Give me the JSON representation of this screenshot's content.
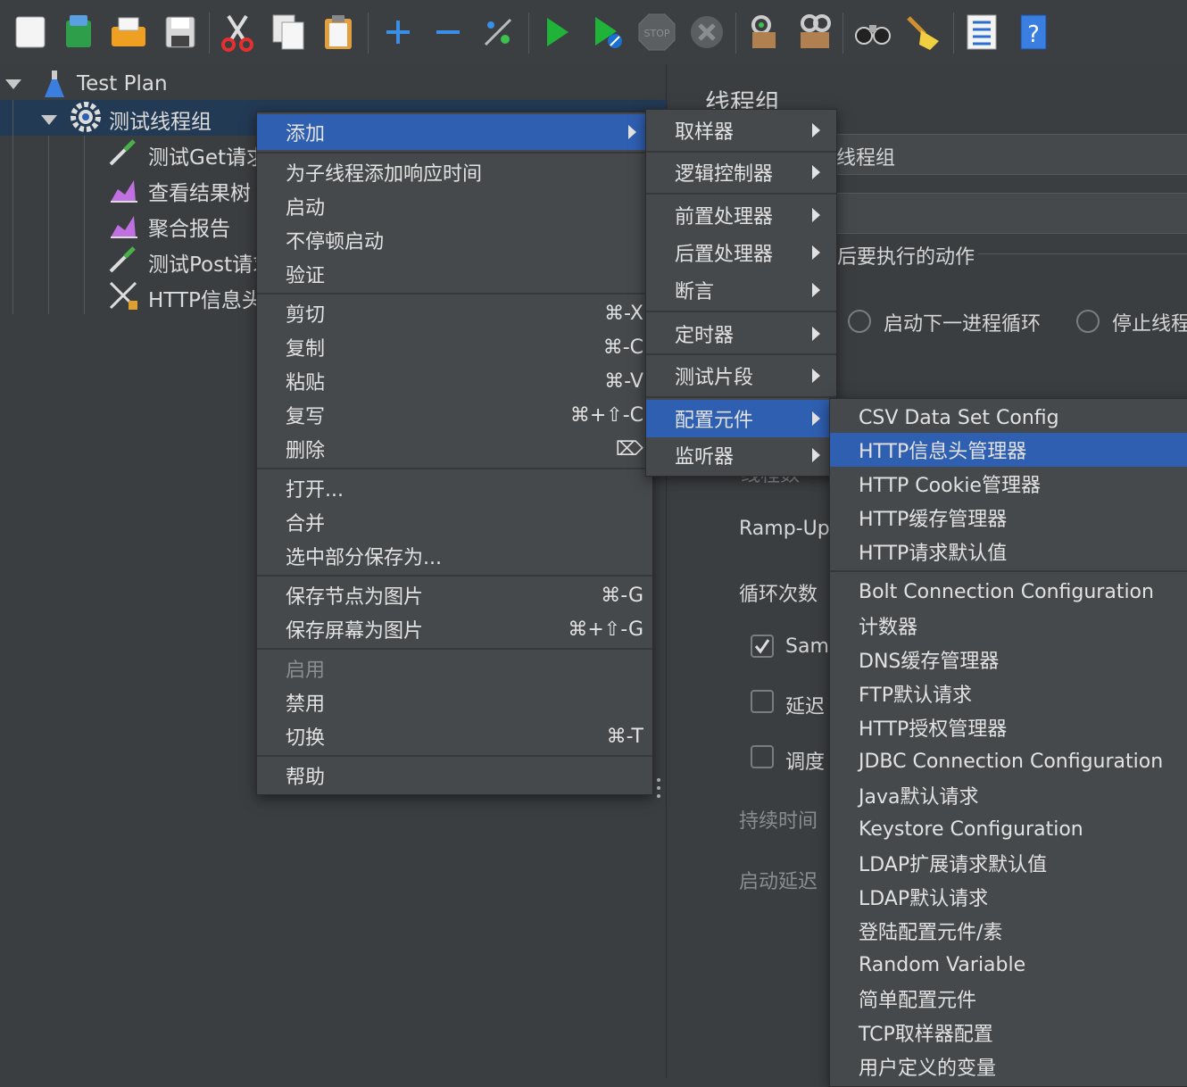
{
  "toolbar": {
    "icons": [
      "new-icon",
      "templates-icon",
      "open-icon",
      "save-icon",
      "cut-icon",
      "copy-icon",
      "paste-icon",
      "expand-icon",
      "collapse-icon",
      "toggle-icon",
      "start-icon",
      "start-no-pause-icon",
      "stop-icon",
      "shutdown-icon",
      "clear-icon",
      "clear-all-icon",
      "search-icon",
      "reset-search-icon",
      "function-helper-icon",
      "help-icon"
    ],
    "stop_text": "STOP",
    "help_text": "?"
  },
  "tree": {
    "root_label": "Test Plan",
    "group_label": "测试线程组",
    "children": [
      {
        "label": "测试Get请求",
        "icon": "sampler-icon"
      },
      {
        "label": "查看结果树",
        "icon": "listener-icon"
      },
      {
        "label": "聚合报告",
        "icon": "listener-icon"
      },
      {
        "label": "测试Post请求",
        "icon": "sampler-icon"
      },
      {
        "label": "HTTP信息头管理器",
        "icon": "config-tools-icon"
      }
    ]
  },
  "right_panel": {
    "title": "线程组",
    "name_value": "线程组",
    "action_label": "后要执行的动作",
    "radio_next_loop": "启动下一进程循环",
    "radio_stop": "停止线程",
    "ramp_label": "Ramp-Up",
    "loop_label": "循环次数",
    "same_user": "Sam",
    "delay_label": "延迟",
    "scheduler_label": "调度",
    "duration_label": "持续时间",
    "startup_delay_label": "启动延迟",
    "threads_label": "线程数"
  },
  "context_menu": {
    "items": [
      {
        "label": "添加",
        "submenu": true,
        "selected": true
      },
      {
        "sep": true
      },
      {
        "label": "为子线程添加响应时间"
      },
      {
        "label": "启动"
      },
      {
        "label": "不停顿启动"
      },
      {
        "label": "验证"
      },
      {
        "sep": true
      },
      {
        "label": "剪切",
        "shortcut": "⌘-X"
      },
      {
        "label": "复制",
        "shortcut": "⌘-C"
      },
      {
        "label": "粘贴",
        "shortcut": "⌘-V"
      },
      {
        "label": "复写",
        "shortcut": "⌘+⇧-C"
      },
      {
        "label": "删除",
        "shortcut": "⌦"
      },
      {
        "sep": true
      },
      {
        "label": "打开..."
      },
      {
        "label": "合并"
      },
      {
        "label": "选中部分保存为..."
      },
      {
        "sep": true
      },
      {
        "label": "保存节点为图片",
        "shortcut": "⌘-G"
      },
      {
        "label": "保存屏幕为图片",
        "shortcut": "⌘+⇧-G"
      },
      {
        "sep": true
      },
      {
        "label": "启用",
        "disabled": true
      },
      {
        "label": "禁用"
      },
      {
        "label": "切换",
        "shortcut": "⌘-T"
      },
      {
        "sep": true
      },
      {
        "label": "帮助"
      }
    ]
  },
  "add_submenu": {
    "items": [
      {
        "label": "取样器",
        "submenu": true
      },
      {
        "sep": true
      },
      {
        "label": "逻辑控制器",
        "submenu": true
      },
      {
        "sep": true
      },
      {
        "label": "前置处理器",
        "submenu": true
      },
      {
        "label": "后置处理器",
        "submenu": true
      },
      {
        "label": "断言",
        "submenu": true
      },
      {
        "sep": true
      },
      {
        "label": "定时器",
        "submenu": true
      },
      {
        "sep": true
      },
      {
        "label": "测试片段",
        "submenu": true
      },
      {
        "sep": true
      },
      {
        "label": "配置元件",
        "submenu": true,
        "selected": true
      },
      {
        "label": "监听器",
        "submenu": true
      }
    ]
  },
  "config_submenu": {
    "items": [
      {
        "label": "CSV Data Set Config"
      },
      {
        "label": "HTTP信息头管理器",
        "selected": true
      },
      {
        "label": "HTTP Cookie管理器"
      },
      {
        "label": "HTTP缓存管理器"
      },
      {
        "label": "HTTP请求默认值"
      },
      {
        "sep": true
      },
      {
        "label": "Bolt Connection Configuration"
      },
      {
        "label": "计数器"
      },
      {
        "label": "DNS缓存管理器"
      },
      {
        "label": "FTP默认请求"
      },
      {
        "label": "HTTP授权管理器"
      },
      {
        "label": "JDBC Connection Configuration"
      },
      {
        "label": "Java默认请求"
      },
      {
        "label": "Keystore Configuration"
      },
      {
        "label": "LDAP扩展请求默认值"
      },
      {
        "label": "LDAP默认请求"
      },
      {
        "label": "登陆配置元件/素"
      },
      {
        "label": "Random Variable"
      },
      {
        "label": "简单配置元件"
      },
      {
        "label": "TCP取样器配置"
      },
      {
        "label": "用户定义的变量"
      }
    ]
  }
}
